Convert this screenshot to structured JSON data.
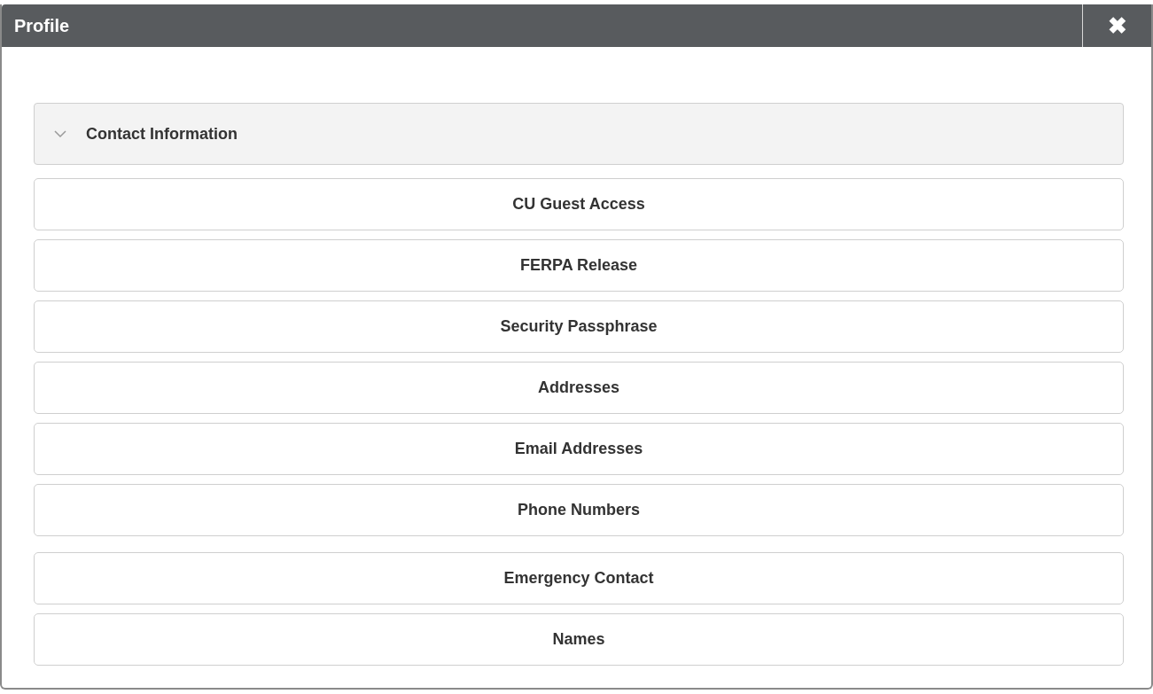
{
  "dialog": {
    "title": "Profile",
    "close_icon": "✖"
  },
  "section": {
    "title": "Contact Information",
    "expanded": true
  },
  "groups": [
    [
      "CU Guest Access",
      "FERPA Release",
      "Security Passphrase",
      "Addresses",
      "Email Addresses",
      "Phone Numbers"
    ],
    [
      "Emergency Contact",
      "Names"
    ]
  ]
}
